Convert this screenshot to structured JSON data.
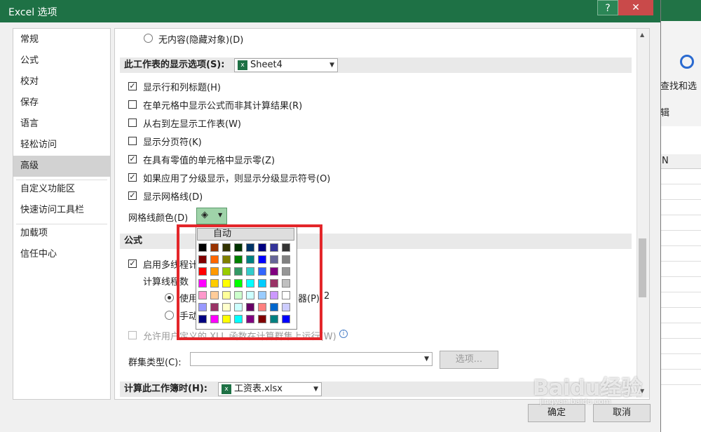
{
  "window": {
    "title": "Excel 选项",
    "help": "?",
    "close": "✕"
  },
  "background": {
    "ribbon_find": "查找和选",
    "ribbon_sub": "辑",
    "column_letter": "N",
    "left_select": "选"
  },
  "nav": {
    "items": [
      {
        "label": "常规",
        "selected": false
      },
      {
        "label": "公式",
        "selected": false
      },
      {
        "label": "校对",
        "selected": false
      },
      {
        "label": "保存",
        "selected": false
      },
      {
        "label": "语言",
        "selected": false
      },
      {
        "label": "轻松访问",
        "selected": false
      },
      {
        "label": "高级",
        "selected": true
      },
      {
        "label": "自定义功能区",
        "selected": false
      },
      {
        "label": "快速访问工具栏",
        "selected": false
      },
      {
        "label": "加载项",
        "selected": false
      },
      {
        "label": "信任中心",
        "selected": false
      }
    ]
  },
  "top_radio": "无内容(隐藏对象)(D)",
  "worksheet_section": {
    "title": "此工作表的显示选项(S):",
    "sheet": "Sheet4"
  },
  "worksheet_options": [
    {
      "label": "显示行和列标题(H)",
      "checked": true
    },
    {
      "label": "在单元格中显示公式而非其计算结果(R)",
      "checked": false
    },
    {
      "label": "从右到左显示工作表(W)",
      "checked": false
    },
    {
      "label": "显示分页符(K)",
      "checked": false
    },
    {
      "label": "在具有零值的单元格中显示零(Z)",
      "checked": true
    },
    {
      "label": "如果应用了分级显示，则显示分级显示符号(O)",
      "checked": true
    },
    {
      "label": "显示网格线(D)",
      "checked": true
    }
  ],
  "grid_color": {
    "label": "网格线颜色(D)"
  },
  "palette": {
    "auto_label": "自动",
    "rows": [
      [
        "#000000",
        "#993300",
        "#333300",
        "#003300",
        "#003366",
        "#000080",
        "#333399",
        "#333333"
      ],
      [
        "#800000",
        "#ff6600",
        "#808000",
        "#008000",
        "#008080",
        "#0000ff",
        "#666699",
        "#808080"
      ],
      [
        "#ff0000",
        "#ff9900",
        "#99cc00",
        "#339966",
        "#33cccc",
        "#3366ff",
        "#800080",
        "#969696"
      ],
      [
        "#ff00ff",
        "#ffcc00",
        "#ffff00",
        "#00ff00",
        "#00ffff",
        "#00ccff",
        "#993366",
        "#c0c0c0"
      ],
      [
        "#ff99cc",
        "#ffcc99",
        "#ffff99",
        "#ccffcc",
        "#ccffff",
        "#99ccff",
        "#cc99ff",
        "#ffffff"
      ],
      [
        "#9999ff",
        "#993366",
        "#ffffcc",
        "#ccffff",
        "#660066",
        "#ff8080",
        "#0066cc",
        "#ccccff"
      ],
      [
        "#000080",
        "#ff00ff",
        "#ffff00",
        "#00ffff",
        "#800080",
        "#800000",
        "#008080",
        "#0000ff"
      ]
    ],
    "highlight_color": "#e3262a"
  },
  "formula_section": {
    "title": "公式",
    "multithread": "启用多线程计",
    "threads_label": "计算线程数",
    "use_label": "使用",
    "processors_suffix": "器(P):",
    "processors_value": "2",
    "manual_label": "手动",
    "xll_label": "允许用户定义的 XLL 函数在计算群集上运行(W)",
    "cluster_label": "群集类型(C):",
    "options_button": "选项..."
  },
  "workbook_section": {
    "title": "计算此工作簿时(H):",
    "file": "工资表.xlsx"
  },
  "buttons": {
    "ok": "确定",
    "cancel": "取消"
  },
  "watermark": {
    "text": "Baidu经验",
    "sub": "jingyan.baidu.com"
  }
}
